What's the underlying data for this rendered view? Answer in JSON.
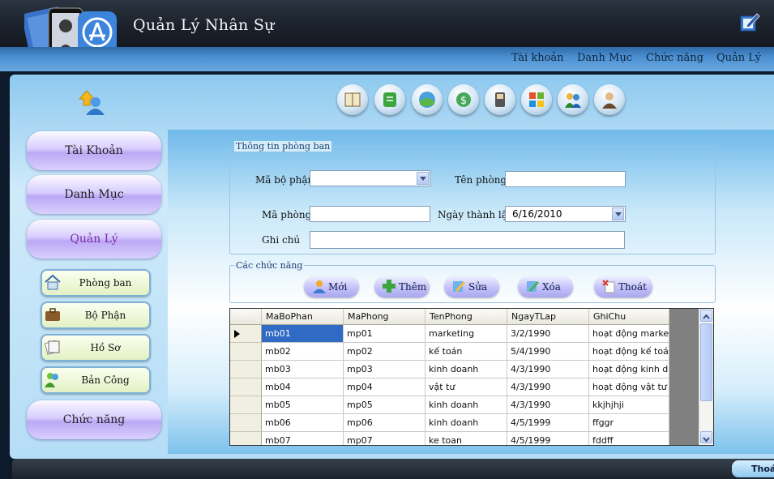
{
  "app": {
    "title": "Quản Lý Nhân Sự"
  },
  "menu": [
    "Tài khoản",
    "Danh Mục",
    "Chức năng",
    "Quản Lý"
  ],
  "toolbar_icons": [
    "book-icon",
    "notepad-icon",
    "globe-icon",
    "money-icon",
    "phone-book-icon",
    "windows-flag-icon",
    "users-icon",
    "user-icon"
  ],
  "nav": {
    "tai_khoan": "Tài Khoản",
    "danh_muc": "Danh Mục",
    "quan_ly": "Quản Lý",
    "chuc_nang": "Chức năng",
    "sub": [
      "Phòng ban",
      "Bộ Phận",
      "Hồ Sơ",
      "Bản Công"
    ]
  },
  "form": {
    "group_title": "Thông tin phòng ban",
    "ma_bo_phan_label": "Mã bộ phận",
    "ma_bo_phan_value": "",
    "ten_phong_label": "Tên phòng",
    "ten_phong_value": "",
    "ma_phong_label": "Mã phòng",
    "ma_phong_value": "",
    "ngay_thanh_lap_label": "Ngày thành lập",
    "ngay_thanh_lap_value": "6/16/2010",
    "ghi_chu_label": "Ghi chú",
    "ghi_chu_value": ""
  },
  "actions": {
    "group_title": "Các chức năng",
    "moi": "Mới",
    "them": "Thêm",
    "sua": "Sửa",
    "xoa": "Xóa",
    "thoat": "Thoát"
  },
  "grid": {
    "columns": [
      "MaBoPhan",
      "MaPhong",
      "TenPhong",
      "NgayTLap",
      "GhiChu"
    ],
    "rows": [
      [
        "mb01",
        "mp01",
        "marketing",
        "3/2/1990",
        "hoạt động marke..."
      ],
      [
        "mb02",
        "mp02",
        "kế toán",
        "5/4/1990",
        "hoạt động kế toán"
      ],
      [
        "mb03",
        "mp03",
        "kinh doanh",
        "4/3/1990",
        "hoạt động kinh d..."
      ],
      [
        "mb04",
        "mp04",
        "vật tư",
        "4/3/1990",
        "hoạt động vật tư"
      ],
      [
        "mb05",
        "mp05",
        "kinh doanh",
        "4/3/1990",
        "kkjhjhji"
      ],
      [
        "mb06",
        "mp06",
        "kinh doanh",
        "4/5/1999",
        "ffggr"
      ],
      [
        "mb07",
        "mp07",
        "ke toan",
        "4/5/1999",
        "fddff"
      ]
    ]
  },
  "footer": {
    "exit": "Thoá"
  },
  "colors": {
    "accent": "#316ac5",
    "nav_purple": "#bba8f5",
    "title_bar": "#1a2029"
  }
}
